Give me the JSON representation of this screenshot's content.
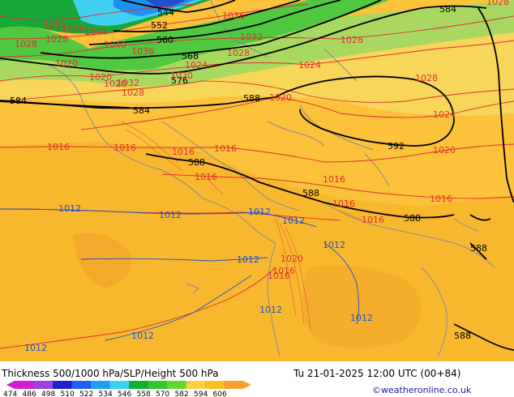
{
  "footer": {
    "title": "Thickness 500/1000 hPa/SLP/Height 500 hPa",
    "datetime": "Tu 21-01-2025 12:00 UTC (00+84)",
    "credit": "©weatheronline.co.uk"
  },
  "colorbar": {
    "ticks": [
      "474",
      "486",
      "498",
      "510",
      "522",
      "534",
      "546",
      "558",
      "570",
      "582",
      "594",
      "606"
    ],
    "colors": [
      "#d020d0",
      "#a040e0",
      "#2020d0",
      "#2060f0",
      "#20a0f0",
      "#40d0f0",
      "#10b030",
      "#30c830",
      "#60d830",
      "#f8d040",
      "#f8c020",
      "#f8a030"
    ]
  },
  "legend": {
    "slp_color": "#e03030",
    "slp_low_color": "#2050d0",
    "height_color": "#000000"
  },
  "map_labels": {
    "h544": "544",
    "h552": "552",
    "h560": "560",
    "h568": "568",
    "h576": "576",
    "h584a": "584",
    "h584b": "584",
    "h584c": "584",
    "h588a": "588",
    "h588b": "588",
    "h588c": "588",
    "h588d": "588",
    "h588e": "588",
    "h588f": "588",
    "h592": "592",
    "p1028a": "1028",
    "p1028b": "1028",
    "p1028c": "1028",
    "p1028d": "1028",
    "p1028e": "1028",
    "p1028f": "1028",
    "p1028g": "1028",
    "p1032a": "1032",
    "p1032b": "1032",
    "p1032c": "1032",
    "p1036a": "1036",
    "p1036b": "1036",
    "p1036c": "1036",
    "p1040": "1040",
    "p1044": "1044",
    "p1024a": "1024",
    "p1024b": "1024",
    "p1024c": "1024",
    "p1020a": "1020",
    "p1020b": "1020",
    "p1020c": "1020",
    "p1020d": "1020",
    "p1020e": "1020",
    "p1020f": "1020",
    "p1020g": "1020",
    "p1016a": "1016",
    "p1016b": "1016",
    "p1016c": "1016",
    "p1016d": "1016",
    "p1016e": "1016",
    "p1016f": "1016",
    "p1016g": "1016",
    "p1016h": "1016",
    "p1016i": "1016",
    "p1016j": "1016",
    "p1016k": "1016",
    "p1012a": "1012",
    "p1012b": "1012",
    "p1012c": "1012",
    "p1012d": "1012",
    "p1012e": "1012",
    "p1012f": "1012",
    "p1012g": "1012",
    "p1012h": "1012",
    "p1012i": "1012",
    "p1012j": "1012"
  }
}
